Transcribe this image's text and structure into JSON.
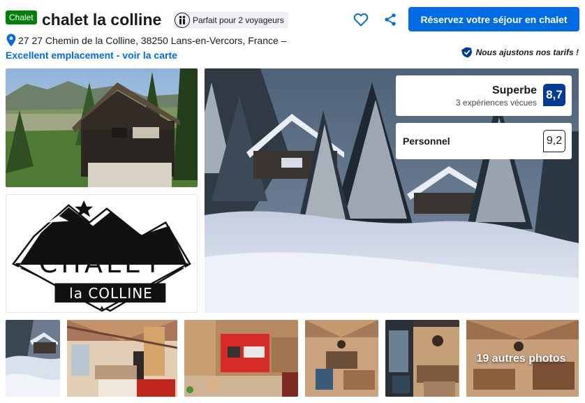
{
  "header": {
    "property_type": "Chalet",
    "title": "chalet la colline",
    "guests_badge": "Parfait pour 2 voyageurs",
    "reserve_button": "Réservez votre séjour en chalet",
    "wishlist_icon": "heart-icon",
    "share_icon": "share-icon"
  },
  "location": {
    "address": "27 27 Chemin de la Colline, 38250 Lans-en-Vercors, France –",
    "map_link": "Excellent emplacement - voir la carte",
    "pin_icon": "map-pin-icon"
  },
  "price_match": {
    "text": "Nous ajustons nos tarifs !",
    "icon": "shield-check-icon"
  },
  "review": {
    "label": "Superbe",
    "subtext": "3 expériences vécues",
    "score": "8,7"
  },
  "staff": {
    "label": "Personnel",
    "score": "9,2"
  },
  "logo": {
    "word1": "CHALET",
    "word2": "la COLLINE"
  },
  "gallery": {
    "more_photos": "19 autres photos"
  },
  "colors": {
    "brand_blue": "#006ce4",
    "score_navy": "#003b95",
    "type_badge_green": "#008009"
  }
}
